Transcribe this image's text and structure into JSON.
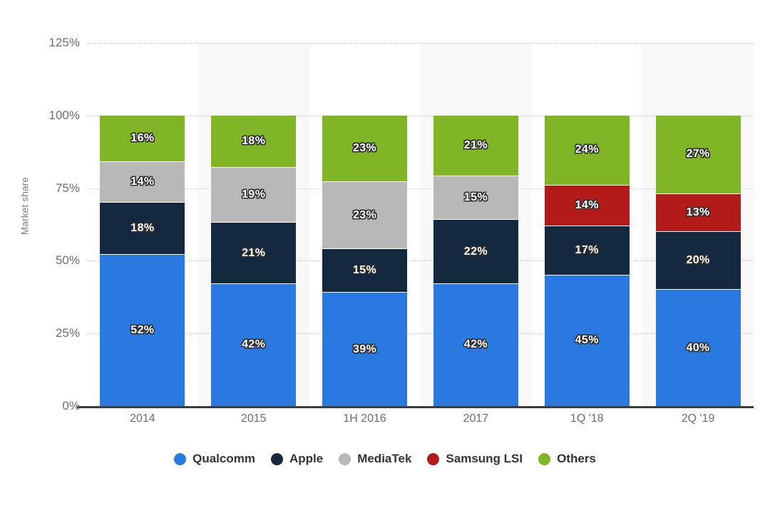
{
  "chart_data": {
    "type": "bar",
    "subtype": "stacked-bar-100",
    "title": "",
    "xlabel": "",
    "ylabel": "Market share",
    "ylim": [
      0,
      125
    ],
    "ytick_values": [
      0,
      25,
      50,
      75,
      100,
      125
    ],
    "ytick_labels": [
      "0%",
      "25%",
      "50%",
      "75%",
      "100%",
      "125%"
    ],
    "grid": true,
    "legend_position": "bottom",
    "categories": [
      "2014",
      "2015",
      "1H 2016",
      "2017",
      "1Q '18",
      "2Q '19"
    ],
    "series": [
      {
        "name": "Qualcomm",
        "color": "#2a79e0",
        "values": [
          52,
          42,
          39,
          42,
          45,
          40
        ],
        "labels": [
          "52%",
          "42%",
          "39%",
          "42%",
          "45%",
          "40%"
        ]
      },
      {
        "name": "Apple",
        "color": "#14293f",
        "values": [
          18,
          21,
          15,
          22,
          17,
          20
        ],
        "labels": [
          "18%",
          "21%",
          "15%",
          "22%",
          "17%",
          "20%"
        ]
      },
      {
        "name": "MediaTek",
        "color": "#b8b8b8",
        "values": [
          14,
          19,
          23,
          15,
          0,
          0
        ],
        "labels": [
          "14%",
          "19%",
          "23%",
          "15%",
          "",
          ""
        ]
      },
      {
        "name": "Samsung LSI",
        "color": "#b31b1b",
        "values": [
          0,
          0,
          0,
          0,
          14,
          13
        ],
        "labels": [
          "",
          "",
          "",
          "",
          "14%",
          "13%"
        ]
      },
      {
        "name": "Others",
        "color": "#80b526",
        "values": [
          16,
          18,
          23,
          21,
          24,
          27
        ],
        "labels": [
          "16%",
          "18%",
          "23%",
          "21%",
          "24%",
          "27%"
        ]
      }
    ]
  },
  "axes": {
    "y_title": "Market share",
    "y_ticks": [
      "125%",
      "100%",
      "75%",
      "50%",
      "25%",
      "0%"
    ],
    "x_ticks": [
      "2014",
      "2015",
      "1H 2016",
      "2017",
      "1Q '18",
      "2Q '19"
    ]
  },
  "legend": {
    "items": [
      {
        "label": "Qualcomm",
        "color": "#2a79e0"
      },
      {
        "label": "Apple",
        "color": "#14293f"
      },
      {
        "label": "MediaTek",
        "color": "#b8b8b8"
      },
      {
        "label": "Samsung LSI",
        "color": "#b31b1b"
      },
      {
        "label": "Others",
        "color": "#80b526"
      }
    ]
  },
  "style": {
    "background": "#ffffff",
    "band_color": "#f8f8f8",
    "gridline_color": "#cfcfcf",
    "axis_line_color": "#3c3c3c",
    "tick_text_color": "#6d6d6d",
    "legend_text_color": "#333333"
  }
}
